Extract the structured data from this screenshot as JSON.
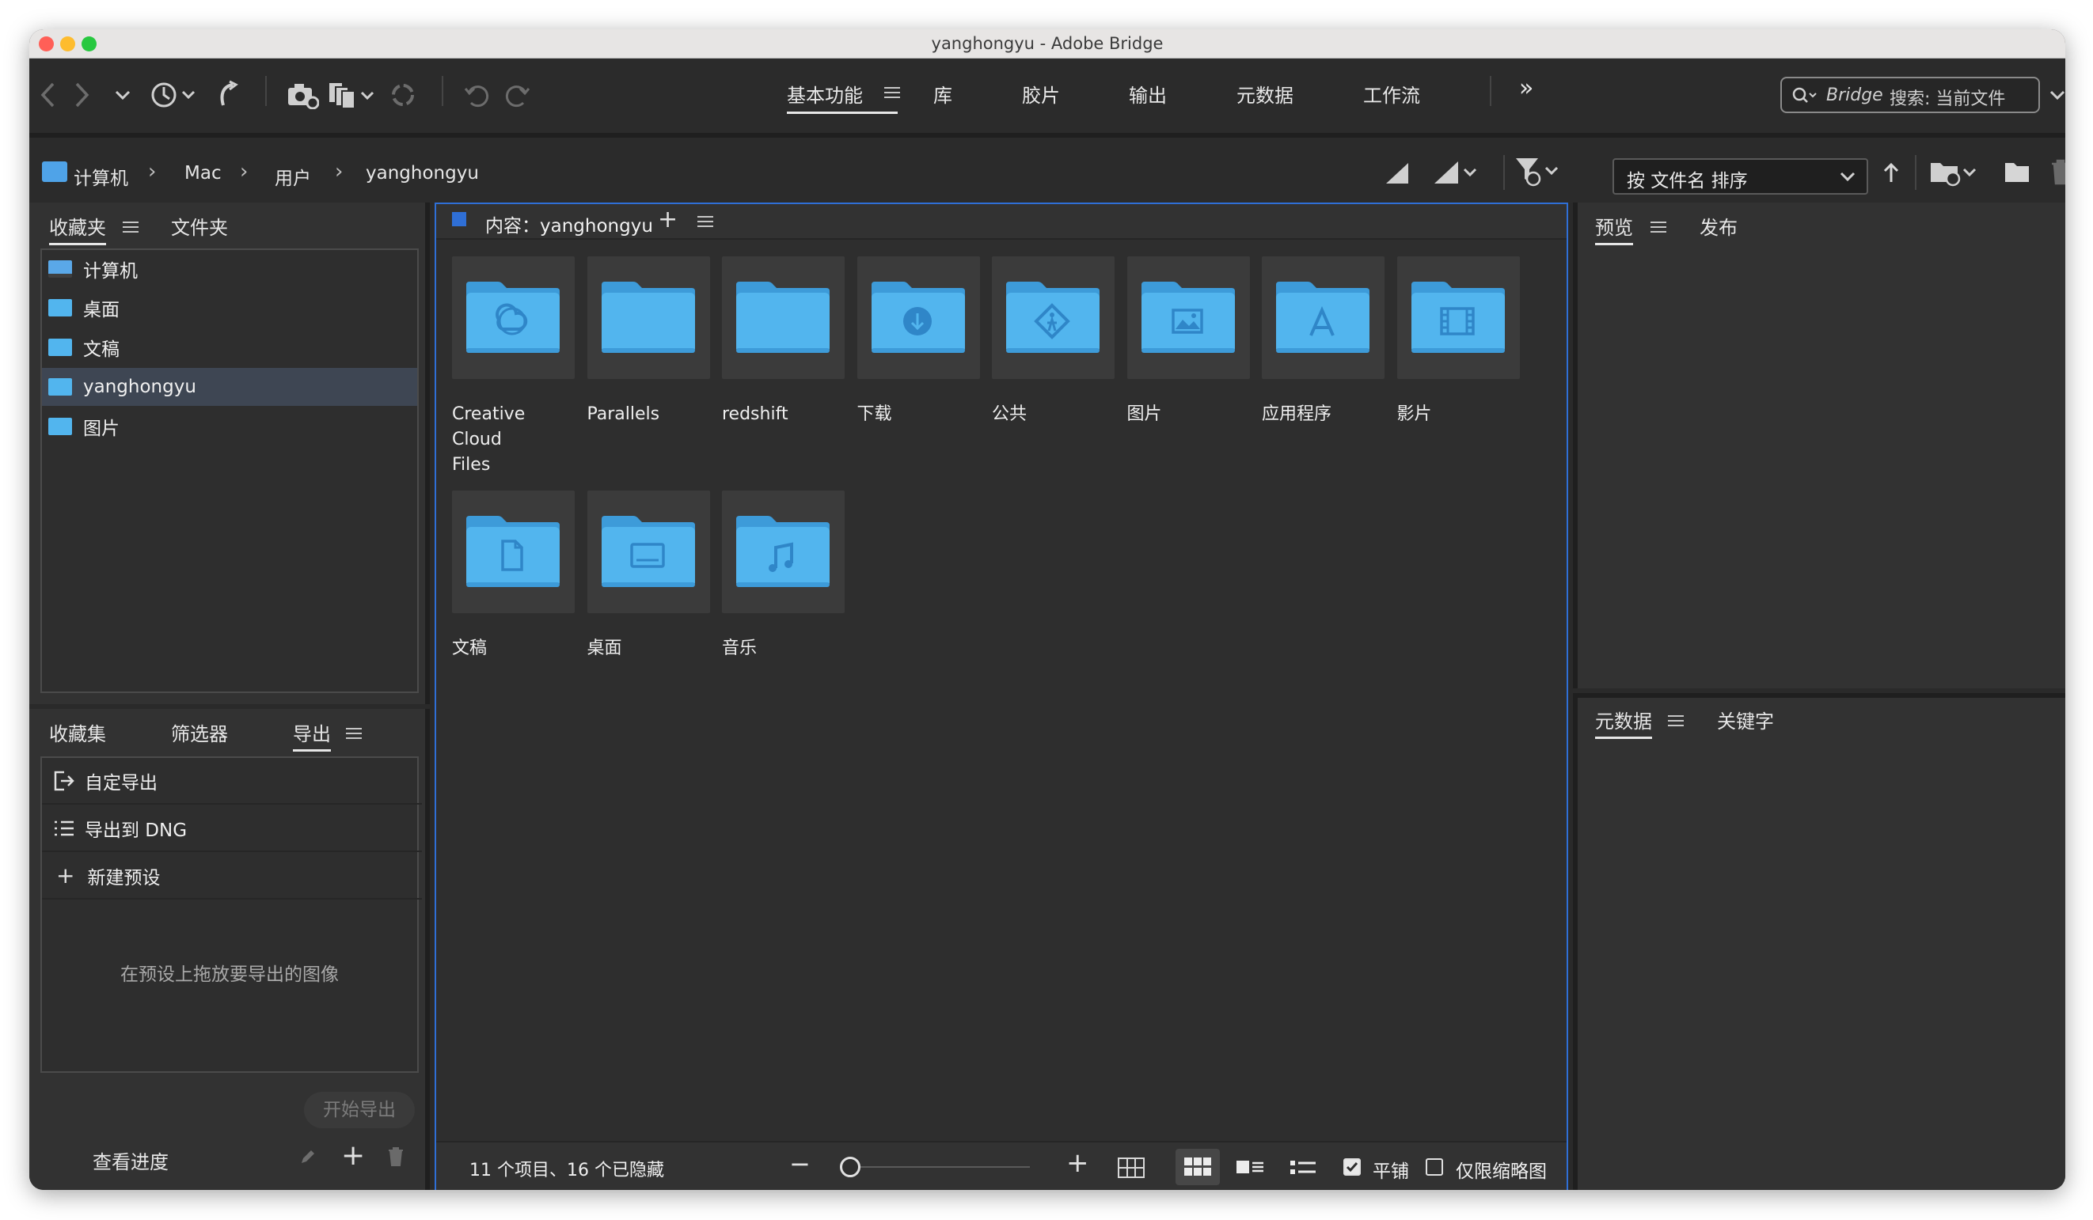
{
  "window": {
    "title": "yanghongyu - Adobe Bridge",
    "traffic_lights": {
      "close": "#ff5f57",
      "minimize": "#febc2e",
      "zoom": "#28c840"
    }
  },
  "toolbar": {
    "workspaces": [
      "基本功能",
      "库",
      "胶片",
      "输出",
      "元数据",
      "工作流"
    ],
    "active_workspace": "基本功能",
    "more_label": "»",
    "search_placeholder_brand": "Bridge",
    "search_placeholder_rest": "搜索: 当前文件"
  },
  "path": {
    "crumbs": [
      "计算机",
      "Mac",
      "用户",
      "yanghongyu"
    ],
    "sort_label": "按 文件名 排序"
  },
  "left_top": {
    "tabs": [
      "收藏夹",
      "文件夹"
    ],
    "active_tab": "收藏夹",
    "favorites": [
      "计算机",
      "桌面",
      "文稿",
      "yanghongyu",
      "图片"
    ],
    "selected_favorite": "yanghongyu"
  },
  "left_bottom": {
    "tabs": [
      "收藏集",
      "筛选器",
      "导出"
    ],
    "active_tab": "导出",
    "export_items": [
      "自定导出",
      "导出到 DNG",
      "新建预设"
    ],
    "drop_hint": "在预设上拖放要导出的图像",
    "start_export": "开始导出",
    "view_progress": "查看进度"
  },
  "content": {
    "header_label": "内容：yanghongyu",
    "items": [
      {
        "name": "Creative Cloud Files",
        "line1": "Creative Cloud",
        "line2": "Files",
        "icon": "creative-cloud-folder-icon"
      },
      {
        "name": "Parallels",
        "line1": "Parallels",
        "line2": "",
        "icon": "folder-icon"
      },
      {
        "name": "redshift",
        "line1": "redshift",
        "line2": "",
        "icon": "folder-icon"
      },
      {
        "name": "下载",
        "line1": "下载",
        "line2": "",
        "icon": "downloads-folder-icon"
      },
      {
        "name": "公共",
        "line1": "公共",
        "line2": "",
        "icon": "public-folder-icon"
      },
      {
        "name": "图片",
        "line1": "图片",
        "line2": "",
        "icon": "pictures-folder-icon"
      },
      {
        "name": "应用程序",
        "line1": "应用程序",
        "line2": "",
        "icon": "applications-folder-icon"
      },
      {
        "name": "影片",
        "line1": "影片",
        "line2": "",
        "icon": "movies-folder-icon"
      },
      {
        "name": "文稿",
        "line1": "文稿",
        "line2": "",
        "icon": "documents-folder-icon"
      },
      {
        "name": "桌面",
        "line1": "桌面",
        "line2": "",
        "icon": "desktop-folder-icon"
      },
      {
        "name": "音乐",
        "line1": "音乐",
        "line2": "",
        "icon": "music-folder-icon"
      }
    ],
    "status": "11 个项目、16 个已隐藏",
    "tile_label": "平铺",
    "tile_checked": true,
    "thumbs_only_label": "仅限缩略图",
    "thumbs_only_checked": false,
    "thumbnail_size": 0
  },
  "right": {
    "top_tabs": [
      "预览",
      "发布"
    ],
    "bottom_tabs": [
      "元数据",
      "关键字"
    ]
  },
  "colors": {
    "folder_front": "#52b5ee",
    "folder_back": "#3d9bd9",
    "folder_glyph": "#2f86c8",
    "panel_bg": "#323232",
    "accent_blue": "#2f6fd6"
  }
}
